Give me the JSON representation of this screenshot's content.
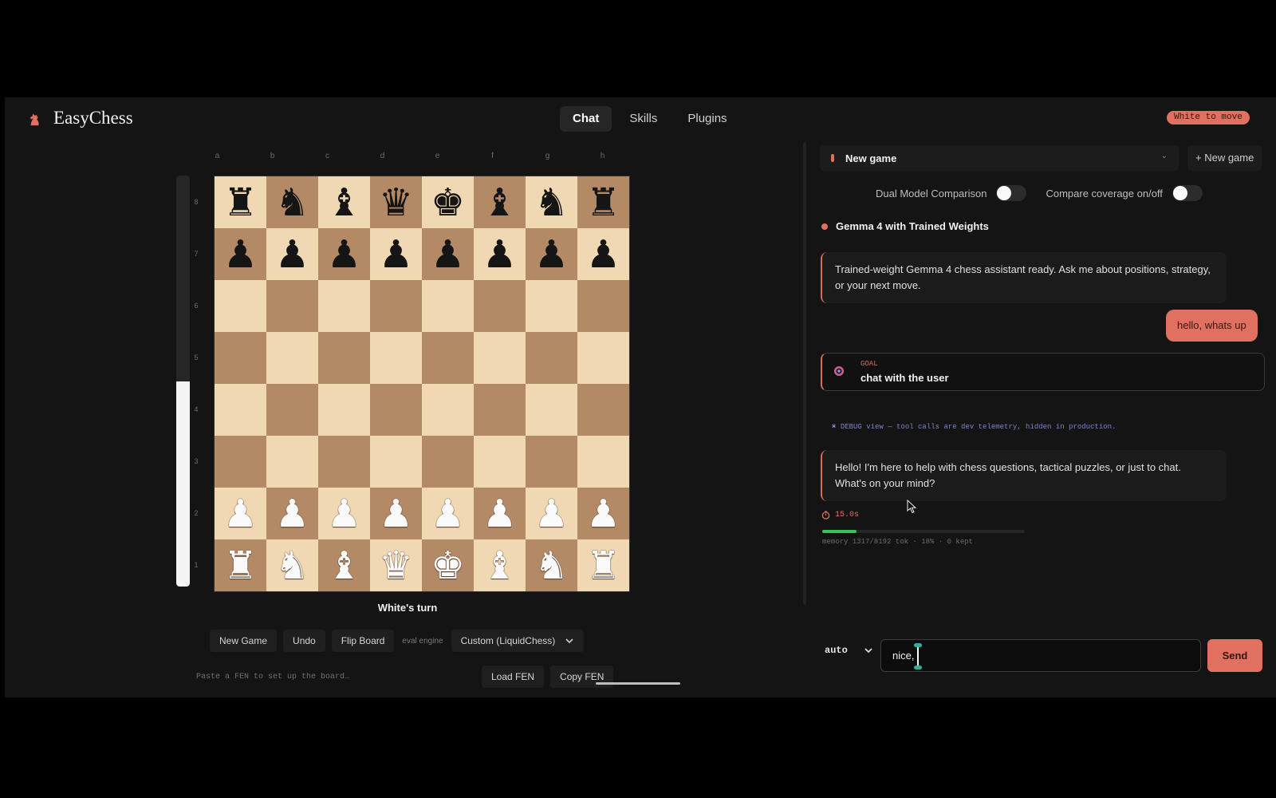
{
  "app": {
    "brand": "EasyChess",
    "nav": [
      "Chat",
      "Skills",
      "Plugins"
    ],
    "active_nav": "Chat",
    "turn_pill": "White to move"
  },
  "board": {
    "files": [
      "a",
      "b",
      "c",
      "d",
      "e",
      "f",
      "g",
      "h"
    ],
    "ranks": [
      "8",
      "7",
      "6",
      "5",
      "4",
      "3",
      "2",
      "1"
    ],
    "eval_white_fraction": 0.5,
    "position": [
      [
        "br",
        "bn",
        "bb",
        "bq",
        "bk",
        "bb",
        "bn",
        "br"
      ],
      [
        "bp",
        "bp",
        "bp",
        "bp",
        "bp",
        "bp",
        "bp",
        "bp"
      ],
      [
        "",
        "",
        "",
        "",
        "",
        "",
        "",
        ""
      ],
      [
        "",
        "",
        "",
        "",
        "",
        "",
        "",
        ""
      ],
      [
        "",
        "",
        "",
        "",
        "",
        "",
        "",
        ""
      ],
      [
        "",
        "",
        "",
        "",
        "",
        "",
        "",
        ""
      ],
      [
        "wp",
        "wp",
        "wp",
        "wp",
        "wp",
        "wp",
        "wp",
        "wp"
      ],
      [
        "wr",
        "wn",
        "wb",
        "wq",
        "wk",
        "wb",
        "wn",
        "wr"
      ]
    ],
    "turn_text": "White's turn"
  },
  "controls": {
    "new_game": "New Game",
    "undo": "Undo",
    "flip_board": "Flip Board",
    "eval_engine_label": "eval engine",
    "engine_selected": "Custom (LiquidChess)",
    "fen_placeholder": "Paste a FEN to set up the board…",
    "load_fen": "Load FEN",
    "copy_fen": "Copy FEN"
  },
  "chat": {
    "session_title": "New game",
    "new_game_button": "+ New game",
    "toggle_dual_label": "Dual Model Comparison",
    "toggle_coverage_label": "Compare coverage on/off",
    "model_name": "Gemma 4 with Trained Weights",
    "messages": [
      {
        "role": "assistant",
        "text": "Trained-weight Gemma 4 chess assistant ready. Ask me about positions, strategy, or your next move."
      },
      {
        "role": "user",
        "text": "hello, whats up"
      },
      {
        "role": "assistant",
        "text": "Hello! I'm here to help with chess questions, tactical puzzles, or just to chat. What's on your mind?"
      }
    ],
    "goal_label": "GOAL",
    "goal_text": "chat with the user",
    "debug_note": "✖ DEBUG view — tool calls are dev telemetry, hidden in production.",
    "timer": "15.0s",
    "memory_fraction": 0.17,
    "memory_text": "memory 1317/8192 tok · 18% · 0 kept",
    "mode": "auto",
    "input_value": "nice,",
    "send": "Send"
  },
  "colors": {
    "accent": "#e07060",
    "light_square": "#f0d8b2",
    "dark_square": "#b48a66",
    "memory_bar": "#3ac25a"
  }
}
